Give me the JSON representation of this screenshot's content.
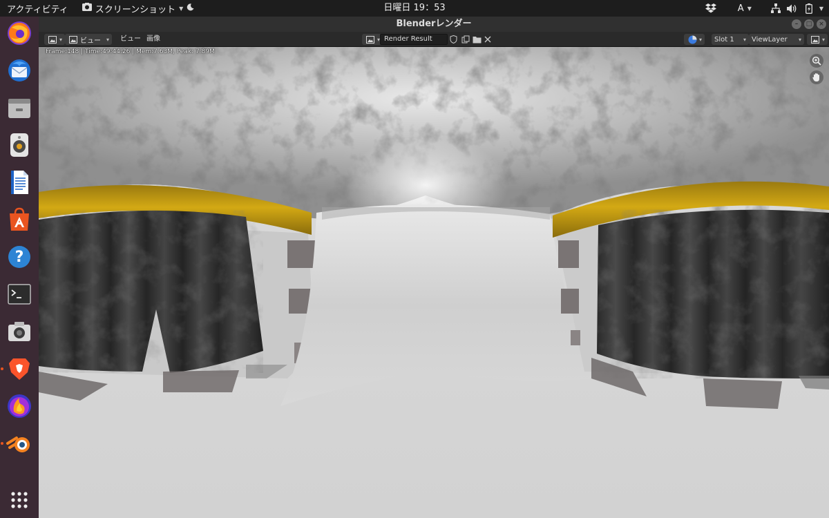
{
  "topbar": {
    "activities": "アクティビティ",
    "app_menu": "スクリーンショット",
    "clock": "日曜日 19：53",
    "input_method": "A"
  },
  "dock": {
    "items": [
      "firefox-icon",
      "thunderbird-icon",
      "files-icon",
      "rhythmbox-icon",
      "writer-icon",
      "software-icon",
      "help-icon",
      "terminal-icon",
      "camera-icon",
      "brave-icon",
      "firefox-dev-icon",
      "blender-icon"
    ],
    "apps_grid": "show-applications-icon"
  },
  "window": {
    "title": "Blenderレンダー"
  },
  "header": {
    "view_menu_1": "ビュー",
    "view_menu_2": "ビュー",
    "image_menu": "画像",
    "image_name": "Render Result",
    "slot": "Slot 1",
    "view_layer": "ViewLayer"
  },
  "render": {
    "stats": "Frame:148 | Time:49:44.26 | Mem:7.63M, Peak: 7.89M"
  },
  "colors": {
    "accent": "#e95420",
    "topbar": "#1d1d1d",
    "dock": "#3b2a34",
    "header": "#2a2a2a",
    "curtain_rail": "#c9a21a"
  }
}
